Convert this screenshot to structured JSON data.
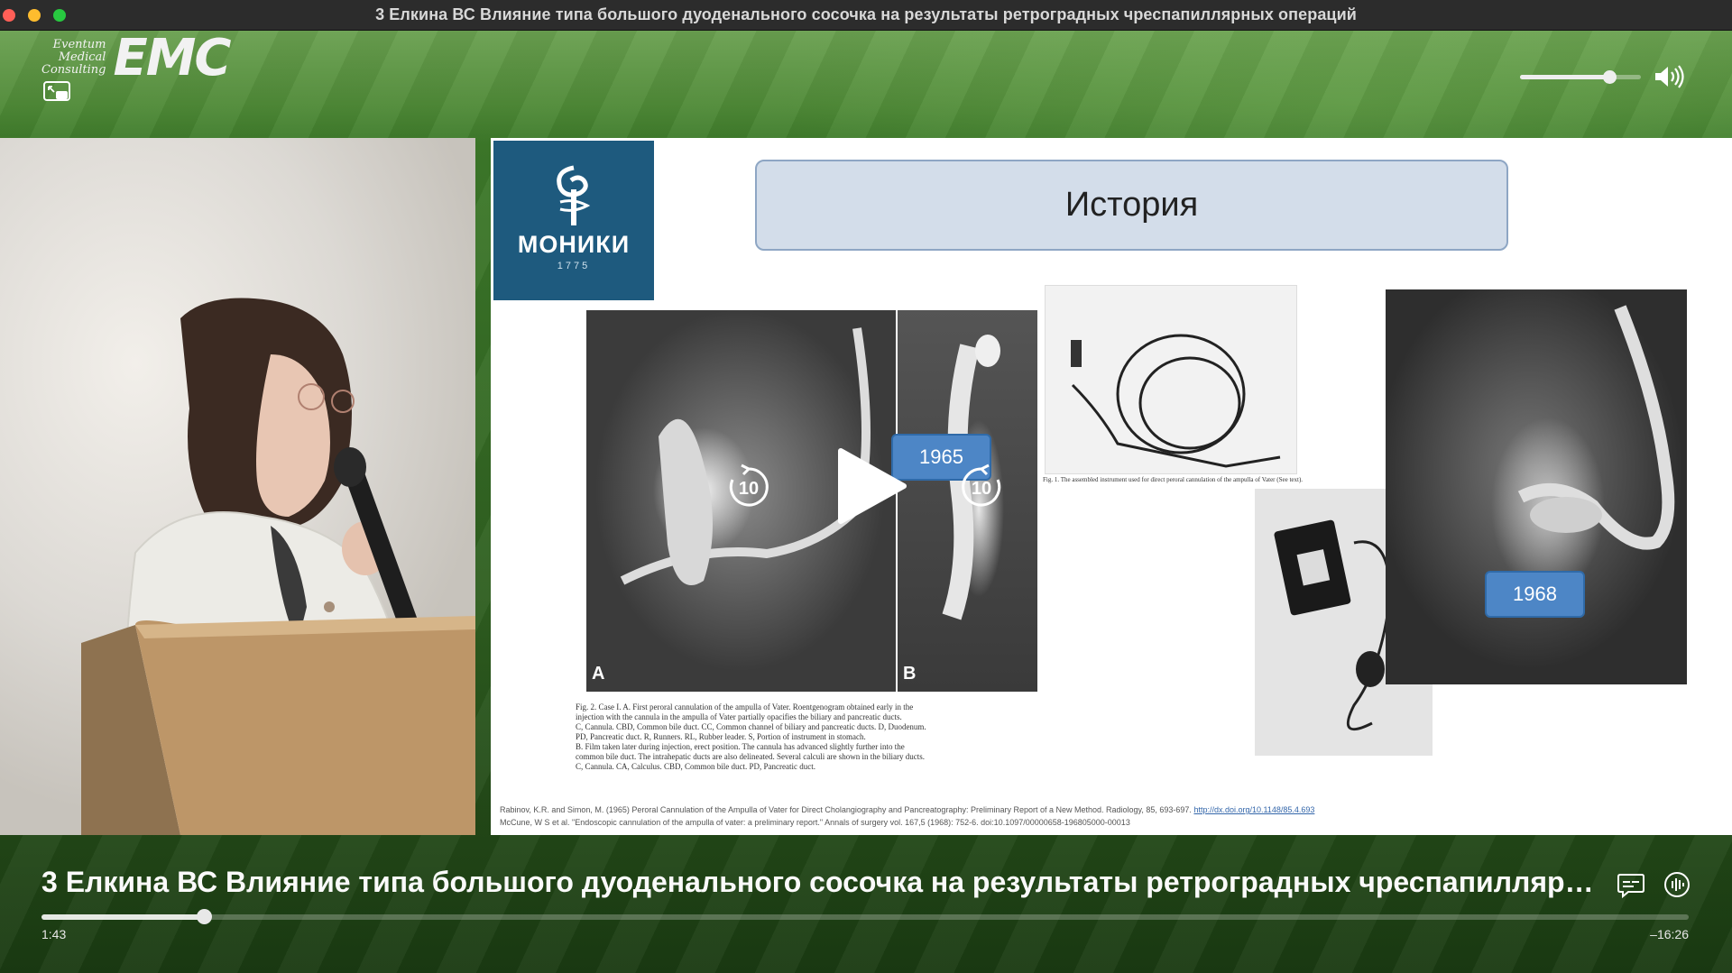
{
  "window": {
    "title": "3 Елкина ВС Влияние типа большого дуоденального сосочка на результаты ретроградных чреспапиллярных операций"
  },
  "branding": {
    "small_text": [
      "Eventum",
      "Medical",
      "Consulting"
    ],
    "big_text": "EMC"
  },
  "volume": {
    "level": 0.74
  },
  "slide": {
    "logo_name": "МОНИКИ",
    "logo_year": "1775",
    "heading": "История",
    "year_1": "1965",
    "year_2": "1968",
    "xray_label_a": "A",
    "xray_label_b": "B",
    "caption_lines": [
      "Fig. 2.  Case I.  A.   First peroral cannulation of the ampulla of Vater.   Roentgenogram obtained early in the",
      "injection with the cannula in the ampulla of Vater partially opacifies the biliary and pancreatic ducts.",
      "C, Cannula.   CBD, Common bile duct.   CC, Common channel of biliary and pancreatic ducts.   D, Duodenum.",
      "PD, Pancreatic duct.   R, Runners.   RL, Rubber leader.   S, Portion of instrument in stomach.",
      "B.   Film taken later during injection, erect position.   The cannula has advanced slightly further into the",
      "common bile duct.   The intrahepatic ducts are also delineated.   Several calculi are shown in the biliary ducts.",
      "C, Cannula.   CA, Calculus.   CBD, Common bile duct.   PD, Pancreatic duct."
    ],
    "instrument_caption": "Fig. 1.   The assembled instrument used for direct peroral cannulation of the ampulla of Vater (See text).",
    "ref_1": "Rabinov, K.R. and Simon, M. (1965) Peroral Cannulation of the Ampulla of Vater for Direct Cholangiography and Pancreatography: Preliminary Report of a New Method. Radiology, 85, 693-697.",
    "ref_1_link": "http://dx.doi.org/10.1148/85.4.693",
    "ref_2": "McCune, W S et al. \"Endoscopic cannulation of the ampulla of vater: a preliminary report.\" Annals of surgery vol. 167,5 (1968): 752-6. doi:10.1097/00000658-196805000-00013"
  },
  "player": {
    "skip_back_label": "10",
    "skip_forward_label": "10",
    "title": "3 Елкина ВС Влияние типа большого дуоденального сосочка на результаты ретроградных чреспапиллярных операций",
    "progress": 0.0987,
    "elapsed": "1:43",
    "remaining": "–16:26"
  },
  "icons": {
    "pip": "picture-in-picture-icon",
    "speaker": "speaker-volume-icon",
    "play": "play-icon",
    "skip_back": "skip-back-10-icon",
    "skip_forward": "skip-forward-10-icon",
    "subtitles": "subtitles-icon",
    "audio": "audio-track-icon"
  }
}
